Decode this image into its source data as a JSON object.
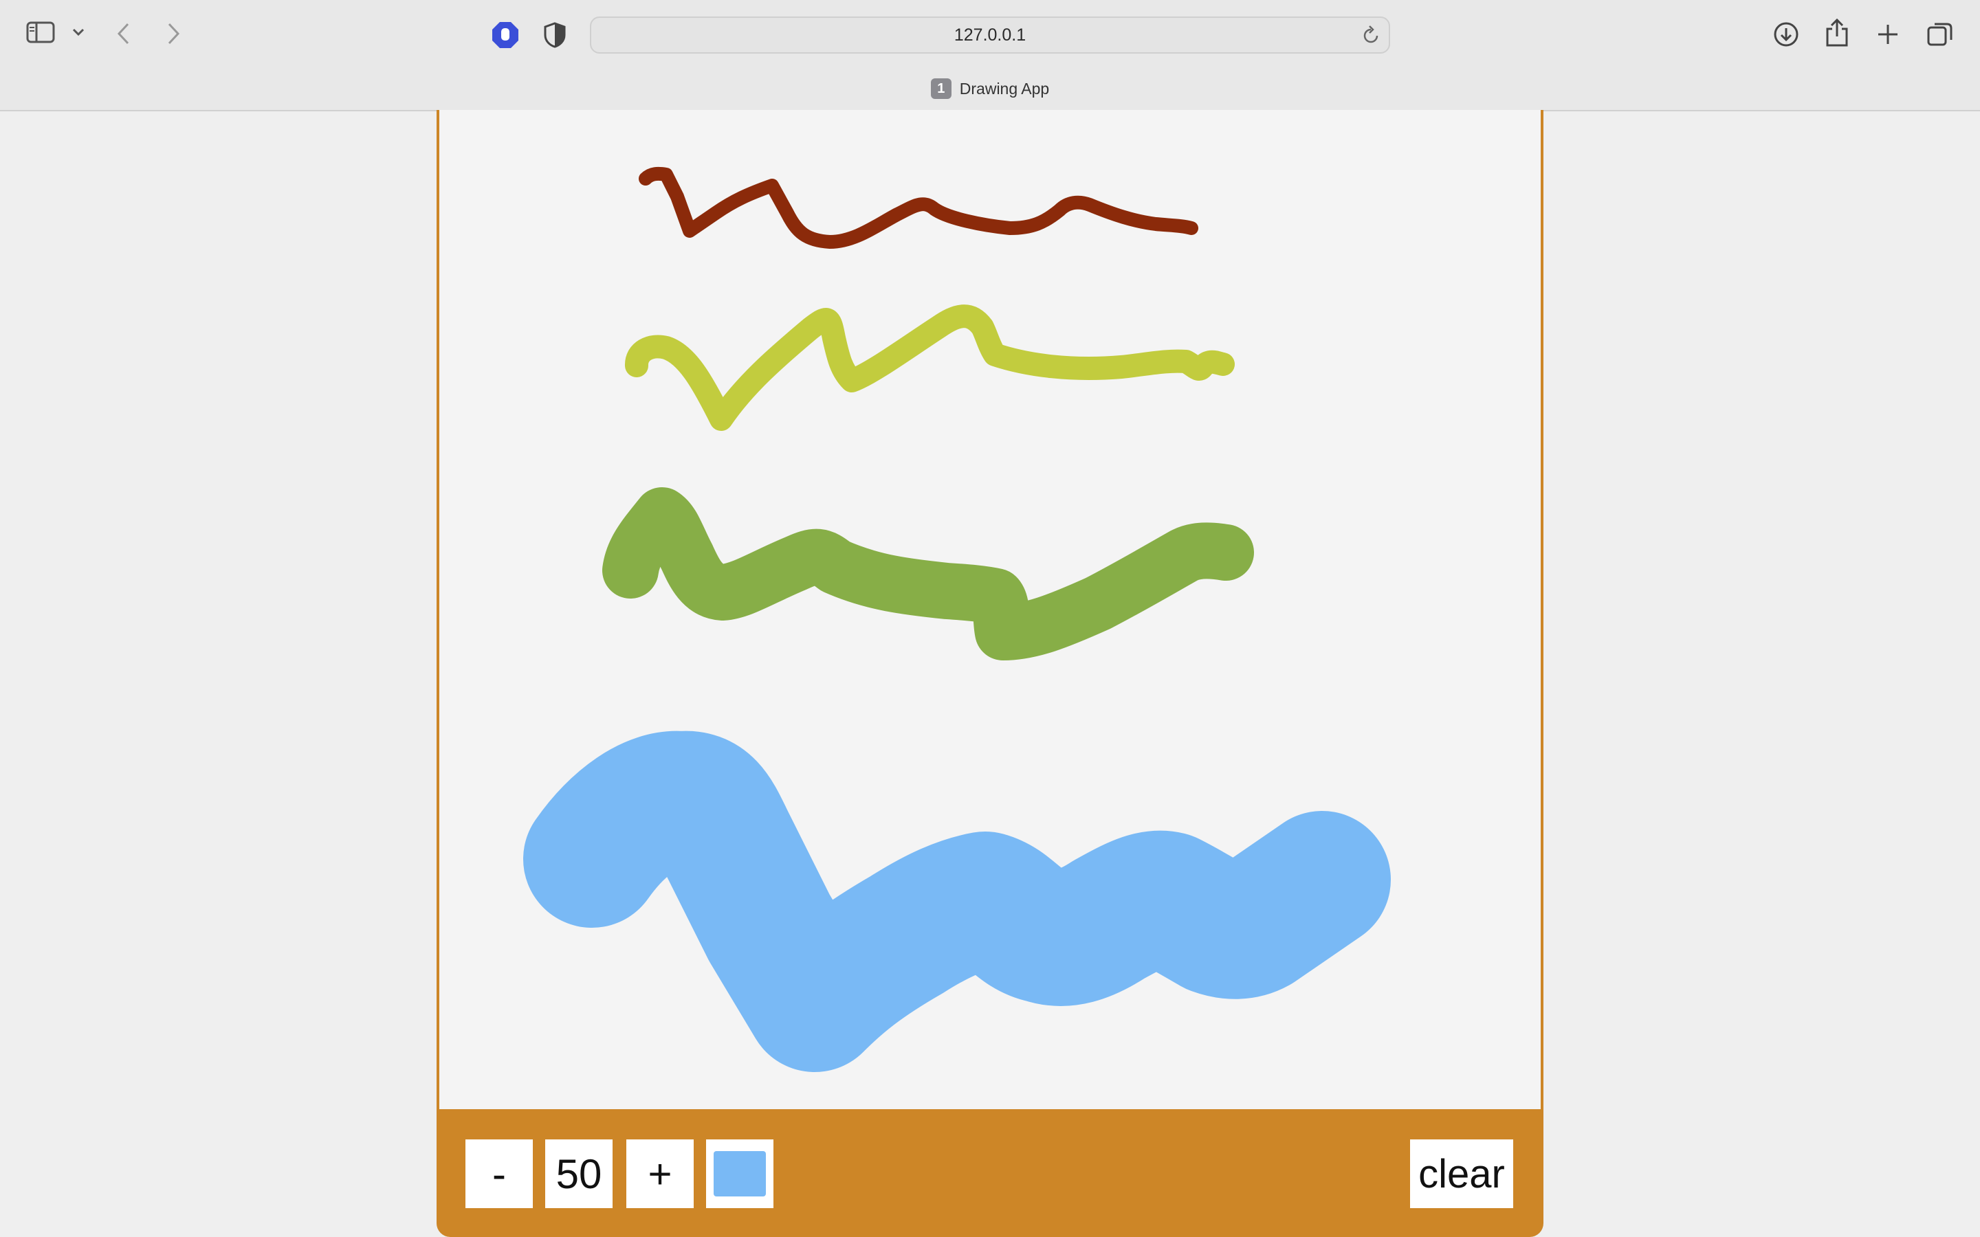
{
  "browser": {
    "address": "127.0.0.1",
    "tab_number": "1",
    "tab_title": "Drawing App"
  },
  "toolbar": {
    "decrease_label": "-",
    "size_value": "50",
    "increase_label": "+",
    "clear_label": "clear",
    "selected_color": "#79b9f5"
  },
  "colors": {
    "frame": "#cd8627",
    "canvas_bg": "#f4f4f4"
  },
  "strokes": [
    {
      "color": "#8b2a0a"
    },
    {
      "color": "#c2cc3e"
    },
    {
      "color": "#87ae47"
    },
    {
      "color": "#79b9f5"
    }
  ]
}
